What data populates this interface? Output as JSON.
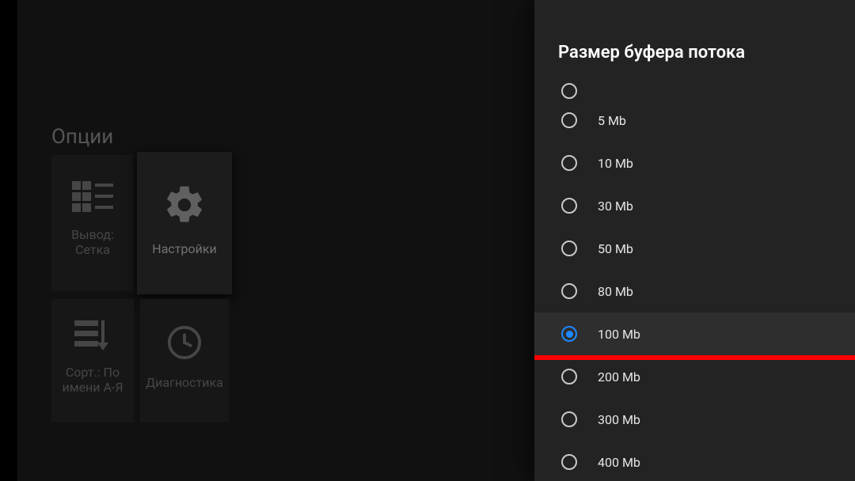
{
  "options_title": "Опции",
  "tiles": {
    "display": {
      "label": "Вывод:\nСетка"
    },
    "settings": {
      "label": "Настройки"
    },
    "sort": {
      "label": "Сорт.: По\nимени А-Я"
    },
    "diag": {
      "label": "Диагностика"
    }
  },
  "panel": {
    "title": "Размер буфера потока",
    "selected_value": "100 Mb",
    "options": [
      {
        "label": "5 Mb"
      },
      {
        "label": "10 Mb"
      },
      {
        "label": "30 Mb"
      },
      {
        "label": "50 Mb"
      },
      {
        "label": "80 Mb"
      },
      {
        "label": "100 Mb"
      },
      {
        "label": "200 Mb"
      },
      {
        "label": "300 Mb"
      },
      {
        "label": "400 Mb"
      }
    ]
  },
  "colors": {
    "panel_bg": "#232323",
    "accent": "#1e88ff",
    "highlight_bar": "#ff0000"
  }
}
